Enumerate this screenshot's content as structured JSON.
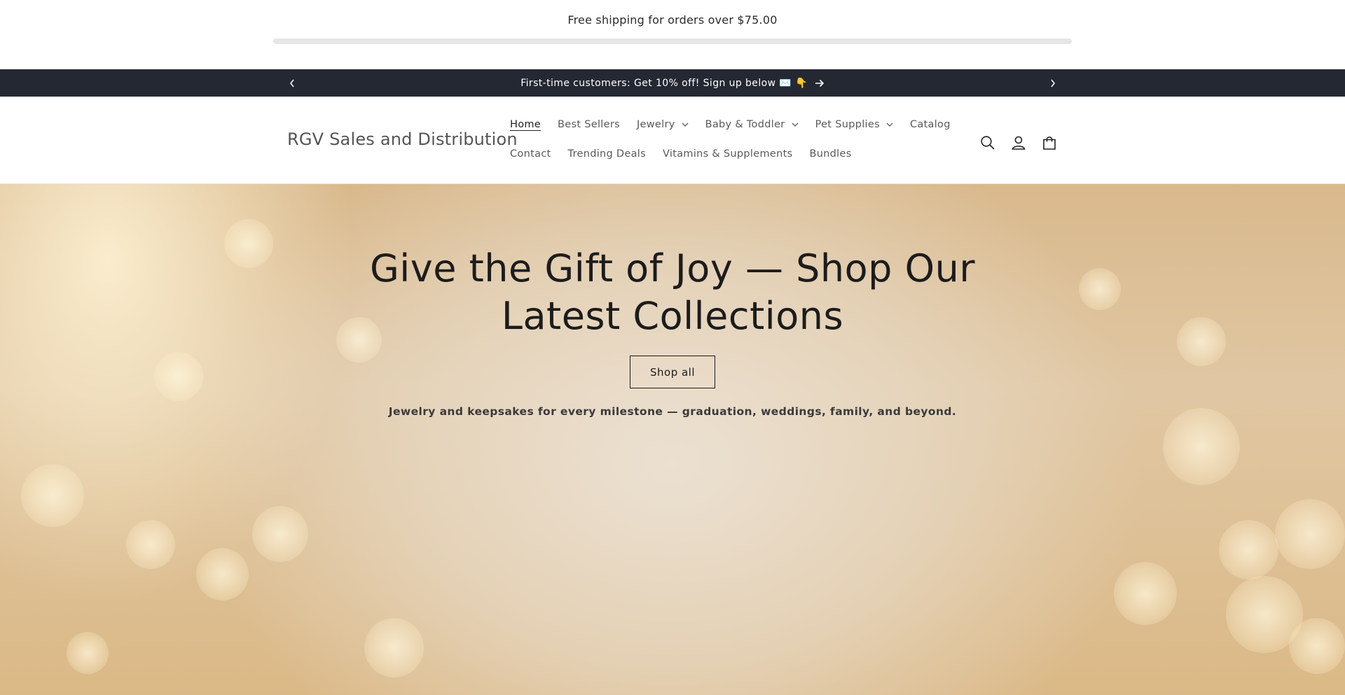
{
  "shipping": {
    "text": "Free shipping for orders over $75.00",
    "progress": 0
  },
  "announcement": {
    "text": "First-time customers: Get 10% off! Sign up below ✉️ 👇",
    "prev_icon": "chevron-left-icon",
    "next_icon": "chevron-right-icon",
    "arrow_icon": "arrow-right-icon"
  },
  "header": {
    "logo": "RGV Sales and Distribution",
    "nav_row1": [
      {
        "label": "Home",
        "active": true
      },
      {
        "label": "Best Sellers"
      },
      {
        "label": "Jewelry",
        "dropdown": true
      },
      {
        "label": "Baby & Toddler",
        "dropdown": true
      },
      {
        "label": "Pet Supplies",
        "dropdown": true
      },
      {
        "label": "Catalog"
      }
    ],
    "nav_row2": [
      {
        "label": "Contact"
      },
      {
        "label": "Trending Deals"
      },
      {
        "label": "Vitamins & Supplements"
      },
      {
        "label": "Bundles"
      }
    ],
    "icons": [
      "search-icon",
      "account-icon",
      "cart-icon"
    ]
  },
  "hero": {
    "title": "Give the Gift of Joy — Shop Our Latest Collections",
    "button": "Shop all",
    "subtitle": "Jewelry and keepsakes for every milestone — graduation, weddings, family, and beyond."
  },
  "colors": {
    "announcement_bg": "#242833",
    "text_dark": "#121212",
    "hero_gold": "#d9b98c"
  }
}
